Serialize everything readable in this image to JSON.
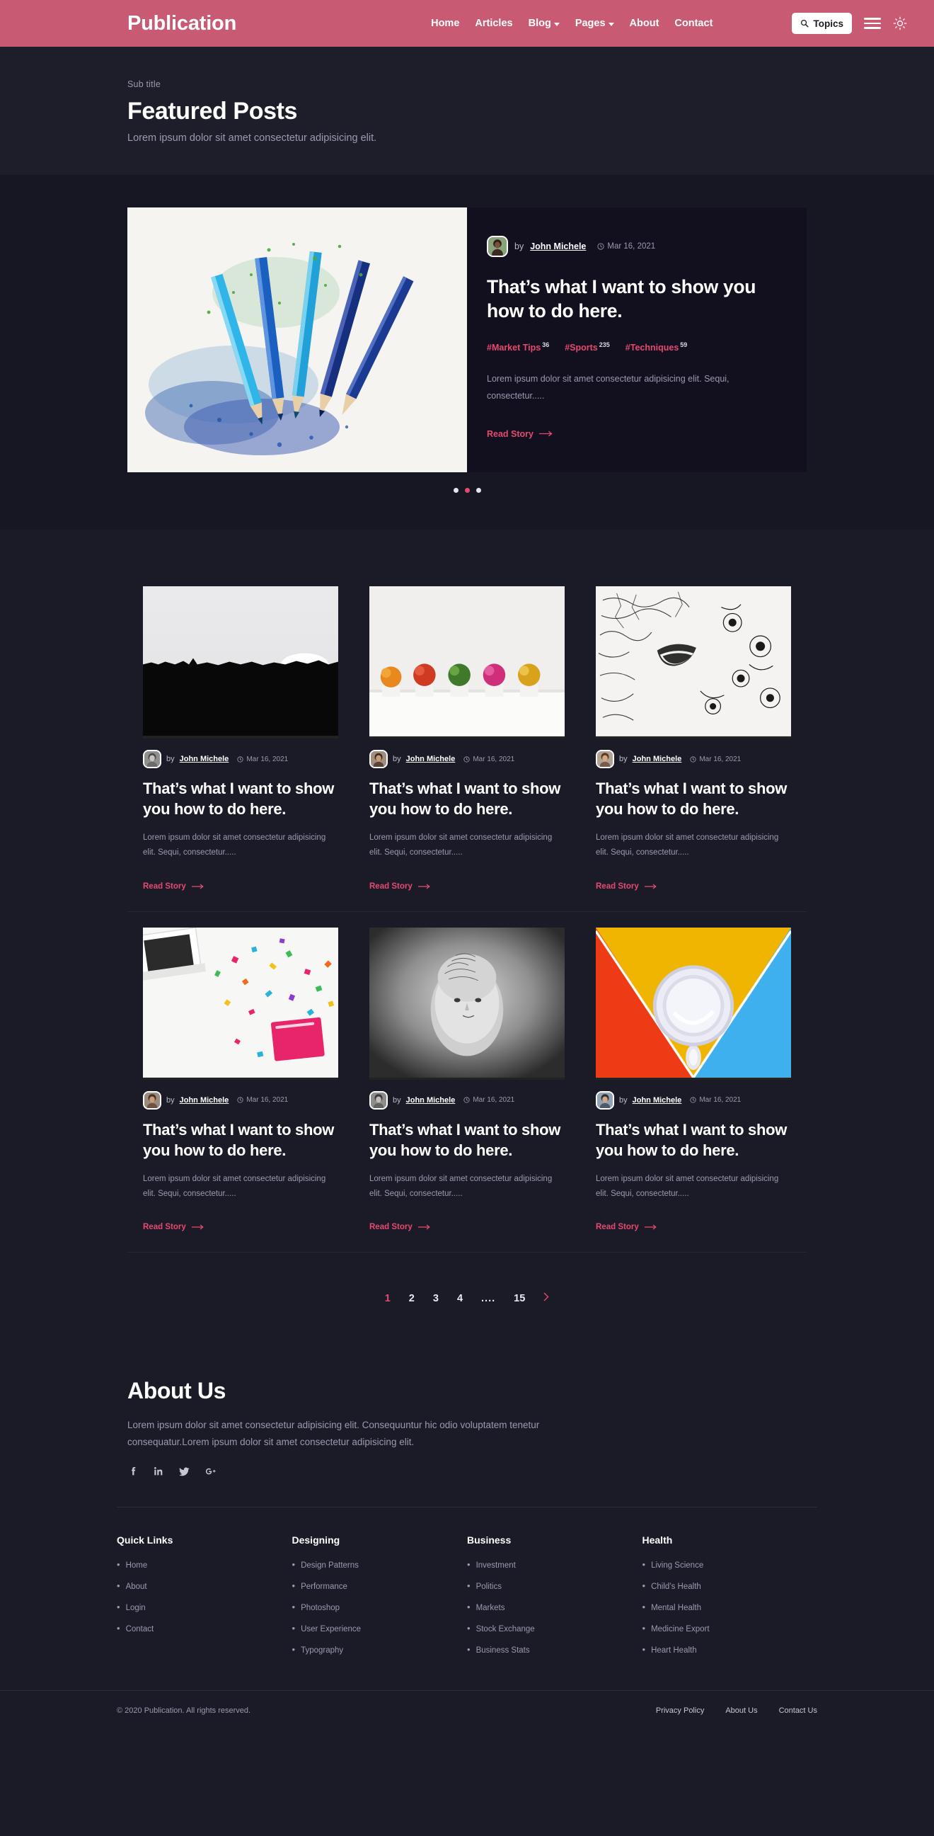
{
  "header": {
    "brand": "Publication",
    "nav": [
      {
        "label": "Home",
        "has_caret": false
      },
      {
        "label": "Articles",
        "has_caret": false
      },
      {
        "label": "Blog",
        "has_caret": true
      },
      {
        "label": "Pages",
        "has_caret": true
      },
      {
        "label": "About",
        "has_caret": false
      },
      {
        "label": "Contact",
        "has_caret": false
      }
    ],
    "topics_button": "Topics",
    "search_icon": "search-icon",
    "menu_icon": "hamburger-icon",
    "theme_icon": "sun-icon",
    "bg_color": "#c85a74"
  },
  "page_head": {
    "subtitle": "Sub title",
    "title": "Featured Posts",
    "description": "Lorem ipsum dolor sit amet consectetur adipisicing elit."
  },
  "featured": {
    "by_label": "by",
    "author": "John Michele",
    "date": "Mar 16, 2021",
    "title": "That’s what I want to show you how to do here.",
    "tags": [
      {
        "label": "#Market Tips",
        "count": "36"
      },
      {
        "label": "#Sports",
        "count": "235"
      },
      {
        "label": "#Techniques",
        "count": "59"
      }
    ],
    "excerpt": "Lorem ipsum dolor sit amet consectetur adipisicing elit. Sequi, consectetur.....",
    "read_more": "Read Story",
    "image_alt": "colored-pencils-shavings",
    "carousel": {
      "total": 3,
      "active_index": 1
    }
  },
  "posts": [
    {
      "by_label": "by",
      "author": "John Michele",
      "date": "Mar 16, 2021",
      "title": "That’s what I want to show you how to do here.",
      "excerpt": "Lorem ipsum dolor sit amet consectetur adipisicing elit. Sequi, consectetur.....",
      "read_more": "Read Story",
      "image_alt": "treeline-silhouette-at-dusk"
    },
    {
      "by_label": "by",
      "author": "John Michele",
      "date": "Mar 16, 2021",
      "title": "That’s what I want to show you how to do here.",
      "excerpt": "Lorem ipsum dolor sit amet consectetur adipisicing elit. Sequi, consectetur.....",
      "read_more": "Read Story",
      "image_alt": "row-of-colorful-potted-flowers"
    },
    {
      "by_label": "by",
      "author": "John Michele",
      "date": "Mar 16, 2021",
      "title": "That’s what I want to show you how to do here.",
      "excerpt": "Lorem ipsum dolor sit amet consectetur adipisicing elit. Sequi, consectetur.....",
      "read_more": "Read Story",
      "image_alt": "black-and-white-floral-face-illustration"
    },
    {
      "by_label": "by",
      "author": "John Michele",
      "date": "Mar 16, 2021",
      "title": "That’s what I want to show you how to do here.",
      "excerpt": "Lorem ipsum dolor sit amet consectetur adipisicing elit. Sequi, consectetur.....",
      "read_more": "Read Story",
      "image_alt": "desk-with-confetti-and-pink-notebook"
    },
    {
      "by_label": "by",
      "author": "John Michele",
      "date": "Mar 16, 2021",
      "title": "That’s what I want to show you how to do here.",
      "excerpt": "Lorem ipsum dolor sit amet consectetur adipisicing elit. Sequi, consectetur.....",
      "read_more": "Read Story",
      "image_alt": "greyscale-mannequin-head-portrait"
    },
    {
      "by_label": "by",
      "author": "John Michele",
      "date": "Mar 16, 2021",
      "title": "That’s what I want to show you how to do here.",
      "excerpt": "Lorem ipsum dolor sit amet consectetur adipisicing elit. Sequi, consectetur.....",
      "read_more": "Read Story",
      "image_alt": "white-cup-on-red-yellow-blue-background"
    }
  ],
  "pagination": {
    "pages": [
      "1",
      "2",
      "3",
      "4",
      "....",
      "15"
    ],
    "active": "1",
    "next_icon": "chevron-right-icon"
  },
  "about": {
    "title": "About Us",
    "text": "Lorem ipsum dolor sit amet consectetur adipisicing elit. Consequuntur hic odio voluptatem tenetur consequatur.Lorem ipsum dolor sit amet consectetur adipisicing elit.",
    "socials": [
      "facebook-icon",
      "linkedin-icon",
      "twitter-icon",
      "googleplus-icon"
    ]
  },
  "footer": {
    "columns": [
      {
        "title": "Quick Links",
        "links": [
          "Home",
          "About",
          "Login",
          "Contact"
        ]
      },
      {
        "title": "Designing",
        "links": [
          "Design Patterns",
          "Performance",
          "Photoshop",
          "User Experience",
          "Typography"
        ]
      },
      {
        "title": "Business",
        "links": [
          "Investment",
          "Politics",
          "Markets",
          "Stock Exchange",
          "Business Stats"
        ]
      },
      {
        "title": "Health",
        "links": [
          "Living Science",
          "Child’s Health",
          "Mental Health",
          "Medicine Export",
          "Heart Health"
        ]
      }
    ],
    "copyright": "© 2020 Publication. All rights reserved.",
    "bottom_links": [
      "Privacy Policy",
      "About Us",
      "Contact Us"
    ]
  },
  "colors": {
    "accent": "#e54a6e",
    "header": "#c85a74",
    "background": "#1b1b28",
    "panel": "#171723",
    "card": "#120f1f"
  }
}
